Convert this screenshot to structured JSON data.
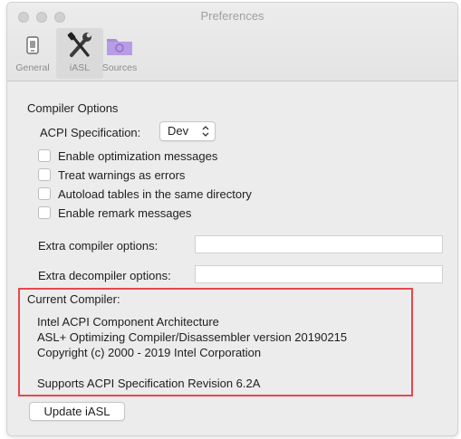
{
  "window": {
    "title": "Preferences"
  },
  "toolbar": {
    "items": [
      {
        "label": "General",
        "icon": "device-icon",
        "selected": false
      },
      {
        "label": "iASL",
        "icon": "tools-icon",
        "selected": true
      },
      {
        "label": "Sources",
        "icon": "folder-icon",
        "selected": false
      }
    ]
  },
  "compiler_options": {
    "section_title": "Compiler Options",
    "acpi_spec_label": "ACPI Specification:",
    "acpi_spec_value": "Dev",
    "checkboxes": [
      {
        "label": "Enable optimization messages",
        "checked": false
      },
      {
        "label": "Treat warnings as errors",
        "checked": false
      },
      {
        "label": "Autoload tables in the same directory",
        "checked": false
      },
      {
        "label": "Enable remark messages",
        "checked": false
      }
    ],
    "extra_compiler_label": "Extra compiler options:",
    "extra_compiler_value": "",
    "extra_decompiler_label": "Extra decompiler options:",
    "extra_decompiler_value": ""
  },
  "current_compiler": {
    "title": "Current Compiler:",
    "lines": [
      "Intel ACPI Component Architecture",
      "ASL+ Optimizing Compiler/Disassembler version 20190215",
      "Copyright (c) 2000 - 2019 Intel Corporation",
      "Supports ACPI Specification Revision 6.2A"
    ],
    "highlight_color": "#e8474f"
  },
  "update_button_label": "Update iASL"
}
